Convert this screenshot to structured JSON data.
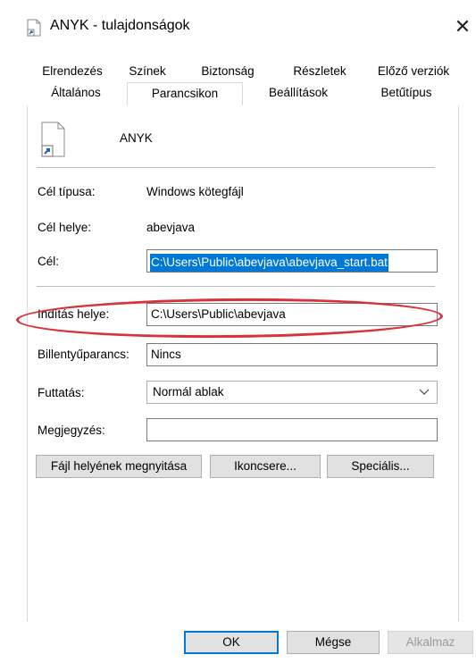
{
  "window": {
    "title": "ANYK - tulajdonságok",
    "close_glyph": "✕"
  },
  "tabs": {
    "row1": [
      "Elrendezés",
      "Színek",
      "Biztonság",
      "Részletek",
      "Előző verziók"
    ],
    "row2": [
      "Általános",
      "Parancsikon",
      "Beállítások",
      "Betűtípus"
    ],
    "active": "Parancsikon"
  },
  "shortcut": {
    "name": "ANYK",
    "target_type_label": "Cél típusa:",
    "target_type_value": "Windows kötegfájl",
    "target_location_label": "Cél helye:",
    "target_location_value": "abevjava",
    "target_label": "Cél:",
    "target_value": "C:\\Users\\Public\\abevjava\\abevjava_start.bat",
    "start_in_label": "Indítás helye:",
    "start_in_value": "C:\\Users\\Public\\abevjava",
    "hotkey_label": "Billentyűparancs:",
    "hotkey_value": "Nincs",
    "run_label": "Futtatás:",
    "run_value": "Normál ablak",
    "comment_label": "Megjegyzés:",
    "comment_value": ""
  },
  "action_buttons": {
    "open_location": "Fájl helyének megnyitása",
    "change_icon": "Ikoncsere...",
    "advanced": "Speciális..."
  },
  "dialog_buttons": {
    "ok": "OK",
    "cancel": "Mégse",
    "apply": "Alkalmaz"
  },
  "colors": {
    "accent": "#0078d7",
    "highlight": "#d8323a"
  },
  "icons": {
    "title": "shortcut-file-icon",
    "shortcut": "shortcut-file-icon",
    "dropdown": "chevron-down-icon"
  }
}
